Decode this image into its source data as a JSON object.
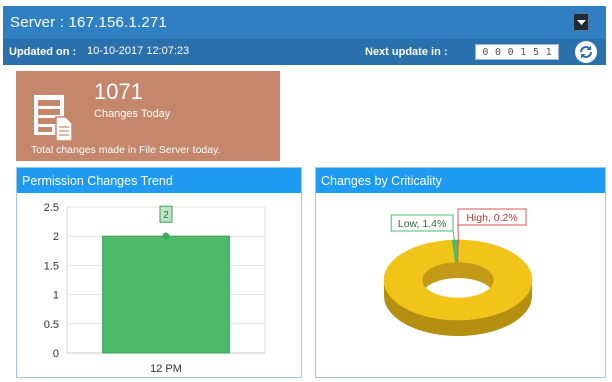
{
  "header": {
    "title": "Server : 167.156.1.271",
    "updated_label": "Updated on :",
    "updated_value": "10-10-2017 12:07:23",
    "next_update_label": "Next update in :",
    "countdown_digits": [
      "0",
      "0",
      "0",
      "1",
      "5",
      "1"
    ]
  },
  "stat": {
    "count": "1071",
    "count_label": "Changes Today",
    "description": "Total changes made in File Server today.",
    "icon": "document-stack-icon"
  },
  "panels": {
    "trend_title": "Permission Changes Trend",
    "criticality_title": "Changes by Criticality"
  },
  "colors": {
    "title_bar": "#2f80c2",
    "info_bar": "#2a70ad",
    "tile": "#c4876c",
    "panel_header": "#1e9af0",
    "bar": "#4dbb6a",
    "low": "#4dbb6a",
    "high": "#d9534f",
    "other": "#f0c419"
  },
  "chart_data": [
    {
      "type": "bar",
      "categories": [
        "12 PM"
      ],
      "values": [
        2
      ],
      "data_labels": [
        "2"
      ],
      "ylim": [
        0,
        2.5
      ],
      "yticks": [
        0,
        0.5,
        1,
        1.5,
        2,
        2.5
      ],
      "ytick_labels": [
        "0",
        "0.5",
        "1",
        "1.5",
        "2",
        "2.5"
      ],
      "grid": true
    },
    {
      "type": "pie",
      "style": "3d-donut",
      "slices": [
        {
          "label": "Low, 1.4%",
          "value": 1.4
        },
        {
          "label": "High, 0.2%",
          "value": 0.2
        },
        {
          "label": "",
          "value": 98.4
        }
      ]
    }
  ]
}
